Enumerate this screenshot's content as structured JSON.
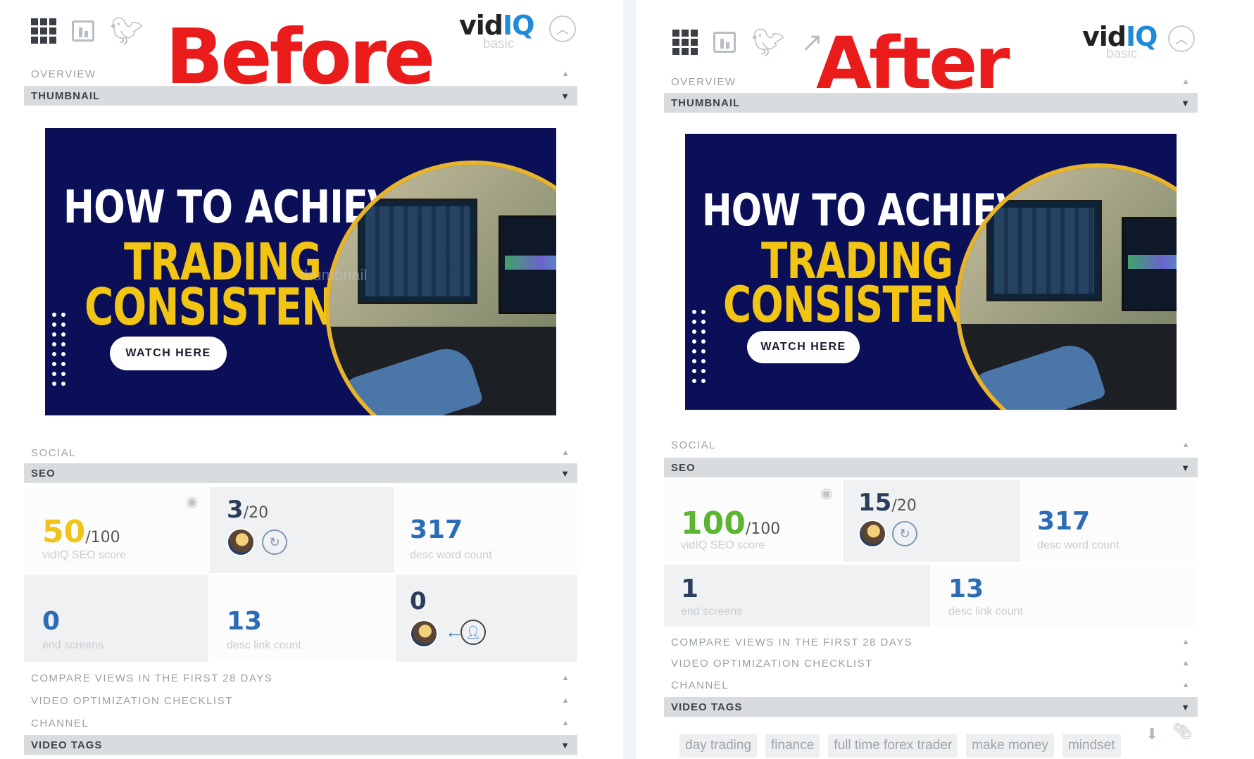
{
  "before": {
    "label": "Before",
    "logo_prefix": "vid",
    "logo_suffix": "IQ",
    "logo_sub": "basic",
    "sections_top": [
      {
        "label": "OVERVIEW",
        "expanded": false
      },
      {
        "label": "THUMBNAIL",
        "expanded": true
      }
    ],
    "thumbnail": {
      "line1": "HOW TO ACHIEVE",
      "line2": "TRADING",
      "line3": "CONSISTENCY",
      "button": "WATCH HERE",
      "watermark": "thumbnail"
    },
    "sections_mid": [
      {
        "label": "SOCIAL",
        "expanded": false
      },
      {
        "label": "SEO",
        "expanded": true
      }
    ],
    "seo": {
      "score": {
        "value": "50",
        "denom": "/100",
        "caption": "vidIQ SEO score"
      },
      "tags": {
        "value": "3",
        "denom": "/20"
      },
      "desc_words": {
        "value": "317",
        "caption": "desc word count"
      },
      "end_screens": {
        "value": "0",
        "caption": "end screens"
      },
      "desc_links": {
        "value": "13",
        "caption": "desc link count"
      },
      "cards": {
        "value": "0"
      }
    },
    "sections_bottom": [
      {
        "label": "COMPARE VIEWS IN THE FIRST 28 DAYS",
        "expanded": false
      },
      {
        "label": "VIDEO OPTIMIZATION CHECKLIST",
        "expanded": false
      },
      {
        "label": "CHANNEL",
        "expanded": false
      },
      {
        "label": "VIDEO TAGS",
        "expanded": true
      }
    ]
  },
  "after": {
    "label": "After",
    "logo_prefix": "vid",
    "logo_suffix": "IQ",
    "logo_sub": "basic",
    "sections_top": [
      {
        "label": "OVERVIEW",
        "expanded": false
      },
      {
        "label": "THUMBNAIL",
        "expanded": true
      }
    ],
    "thumbnail": {
      "line1": "HOW TO ACHIEVE",
      "line2": "TRADING",
      "line3": "CONSISTENCY",
      "button": "WATCH HERE"
    },
    "sections_mid": [
      {
        "label": "SOCIAL",
        "expanded": false
      },
      {
        "label": "SEO",
        "expanded": true
      }
    ],
    "seo": {
      "score": {
        "value": "100",
        "denom": "/100",
        "caption": "vidIQ SEO score"
      },
      "tags": {
        "value": "15",
        "denom": "/20"
      },
      "desc_words": {
        "value": "317",
        "caption": "desc word count"
      },
      "end_screens": {
        "value": "1",
        "caption": "end screens"
      },
      "desc_links": {
        "value": "13",
        "caption": "desc link count"
      }
    },
    "sections_bottom": [
      {
        "label": "COMPARE VIEWS IN THE FIRST 28 DAYS",
        "expanded": false
      },
      {
        "label": "VIDEO OPTIMIZATION CHECKLIST",
        "expanded": false
      },
      {
        "label": "CHANNEL",
        "expanded": false
      },
      {
        "label": "VIDEO TAGS",
        "expanded": true
      }
    ],
    "video_tags": [
      "day trading",
      "finance",
      "full time forex trader",
      "make money",
      "mindset"
    ]
  },
  "colors": {
    "label_red": "#ea1b1b",
    "score_yellow": "#f0c419",
    "score_green": "#5cb531",
    "metric_blue": "#2a6cb5",
    "brand_blue": "#1f8bd8",
    "thumbnail_navy": "#0b0f57",
    "thumbnail_gold": "#f2c414"
  },
  "icons": [
    "apps-grid-icon",
    "analytics-icon",
    "twitter-icon",
    "trend-icon",
    "chevron-up-icon",
    "eye-icon",
    "refresh-icon",
    "add-user-icon",
    "download-icon",
    "paperclip-icon"
  ]
}
